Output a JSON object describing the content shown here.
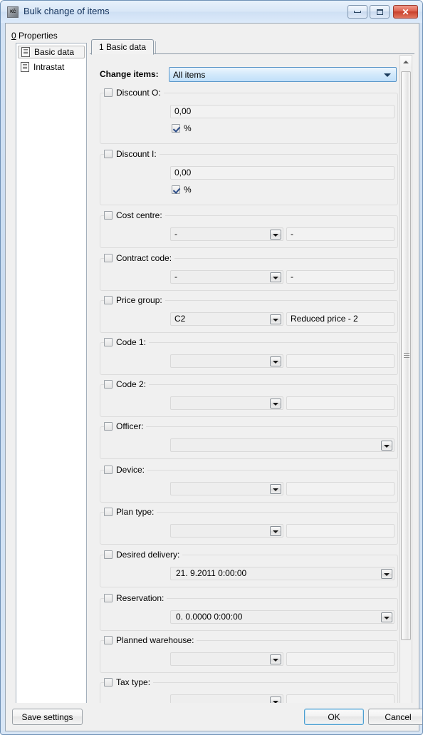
{
  "window": {
    "title": "Bulk change of items",
    "icon": "currency-document-icon",
    "buttons": {
      "minimize": "minimize-icon",
      "maximize": "restore-icon",
      "close": "✕"
    }
  },
  "left_panel": {
    "header_accesskey": "0",
    "header_label": " Properties",
    "items": [
      {
        "label": "Basic data",
        "selected": true
      },
      {
        "label": "Intrastat",
        "selected": false
      }
    ]
  },
  "tabs": [
    {
      "label": "1 Basic data",
      "active": true
    }
  ],
  "form": {
    "change_items": {
      "label": "Change items:",
      "value": "All items"
    },
    "groups": [
      {
        "id": "discount-o",
        "title": "Discount O:",
        "checked": false,
        "value": "0,00",
        "percent_label": "%",
        "percent_checked": true
      },
      {
        "id": "discount-i",
        "title": "Discount I:",
        "checked": false,
        "value": "0,00",
        "percent_label": "%",
        "percent_checked": true
      },
      {
        "id": "cost-centre",
        "title": "Cost centre:",
        "checked": false,
        "code": "-",
        "description": "-"
      },
      {
        "id": "contract-code",
        "title": "Contract code:",
        "checked": false,
        "code": "-",
        "description": "-"
      },
      {
        "id": "price-group",
        "title": "Price group:",
        "checked": false,
        "code": "C2",
        "description": "Reduced price  - 2"
      },
      {
        "id": "code-1",
        "title": "Code 1:",
        "checked": false,
        "code": "",
        "description": ""
      },
      {
        "id": "code-2",
        "title": "Code 2:",
        "checked": false,
        "code": "",
        "description": ""
      },
      {
        "id": "officer",
        "title": "Officer:",
        "checked": false,
        "value": ""
      },
      {
        "id": "device",
        "title": "Device:",
        "checked": false,
        "code": "",
        "description": ""
      },
      {
        "id": "plan-type",
        "title": "Plan type:",
        "checked": false,
        "code": "",
        "description": ""
      },
      {
        "id": "desired-delivery",
        "title": "Desired delivery:",
        "checked": false,
        "value": "21. 9.2011 0:00:00"
      },
      {
        "id": "reservation",
        "title": "Reservation:",
        "checked": false,
        "value": "0. 0.0000  0:00:00"
      },
      {
        "id": "planned-warehouse",
        "title": "Planned warehouse:",
        "checked": false,
        "code": "",
        "description": ""
      },
      {
        "id": "tax-type",
        "title": "Tax type:",
        "checked": false,
        "code": "",
        "description": ""
      }
    ]
  },
  "footer": {
    "save_settings": "Save settings",
    "ok": "OK",
    "cancel": "Cancel"
  }
}
